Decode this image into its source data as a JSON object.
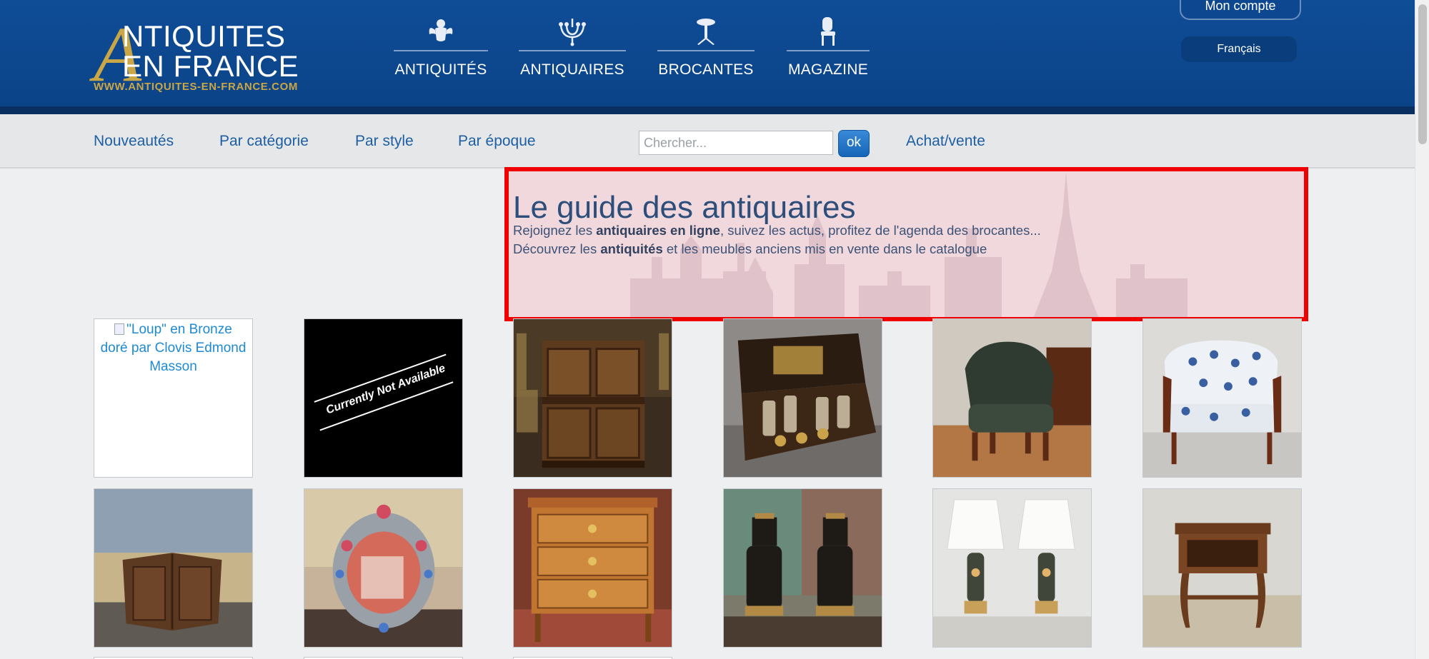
{
  "header": {
    "logo": {
      "initial": "A",
      "line1": "NTIQUITES",
      "line2": "EN FRANCE",
      "url": "WWW.ANTIQUITES-EN-FRANCE.COM"
    },
    "nav": [
      {
        "label": "ANTIQUITÉS",
        "icon": "angel-icon"
      },
      {
        "label": "ANTIQUAIRES",
        "icon": "chandelier-icon"
      },
      {
        "label": "BROCANTES",
        "icon": "pedestal-table-icon"
      },
      {
        "label": "MAGAZINE",
        "icon": "chair-icon"
      }
    ],
    "account_label": "Mon compte",
    "language_label": "Français"
  },
  "subnav": {
    "links": [
      "Nouveautés",
      "Par catégorie",
      "Par style",
      "Par époque"
    ],
    "search_placeholder": "Chercher...",
    "search_button": "ok",
    "trade_link": "Achat/vente"
  },
  "hero": {
    "title": "Le guide des antiquaires",
    "line1_pre": "Rejoignez les ",
    "line1_bold": "antiquaires en ligne",
    "line1_post": ", suivez les actus, profitez de l'agenda des brocantes...",
    "line2_pre": "Découvrez les ",
    "line2_bold": "antiquités",
    "line2_post": " et les meubles anciens mis en vente dans le catalogue",
    "highlight_color": "#f00000"
  },
  "products": [
    {
      "alt": "\"Loup\" en Bronze doré par Clovis Edmond Masson",
      "image": "broken"
    },
    {
      "label": "Currently Not Available",
      "image": "not-available"
    },
    {
      "image": "antique-cabinet"
    },
    {
      "image": "liquor-cellar-box"
    },
    {
      "image": "leather-armchair"
    },
    {
      "image": "floral-bergere"
    },
    {
      "image": "corner-cabinet"
    },
    {
      "image": "venetian-mirror"
    },
    {
      "image": "chest-of-drawers"
    },
    {
      "image": "oil-lamps"
    },
    {
      "image": "table-lamps"
    },
    {
      "image": "bedside-table"
    }
  ]
}
